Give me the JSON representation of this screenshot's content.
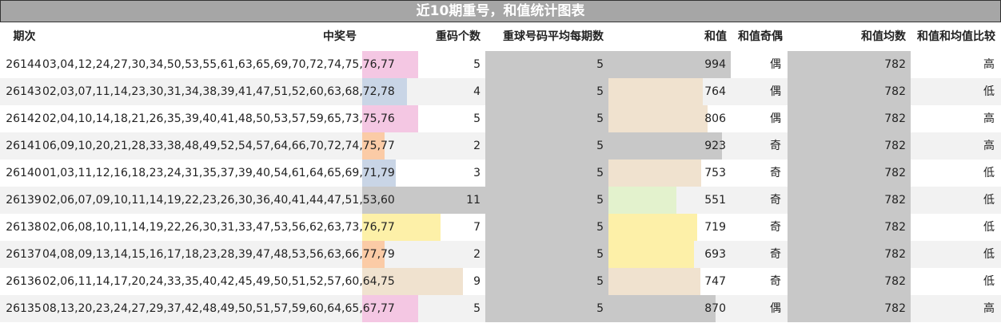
{
  "title": "近10期重号，和值统计图表",
  "headers": {
    "issue": "期次",
    "numbers": "中奖号",
    "repeat_count": "重码个数",
    "avg_repeat": "重球号码平均每期数",
    "sum": "和值",
    "parity": "和值奇偶",
    "sum_avg": "和值均数",
    "compare": "和值和均值比较"
  },
  "colors": {
    "pink": "#f4c7e3",
    "blue": "#c9d5e6",
    "orange": "#fbcba6",
    "gray": "#c8c8c8",
    "yellow": "#fdf0a8",
    "tan": "#f0e2cf",
    "green": "#e3f2cd",
    "stripe": "#f2f2f2"
  },
  "rows": [
    {
      "issue": "26144",
      "numbers": "03,04,12,24,27,30,34,50,53,55,61,63,65,69,70,72,74,75,76,77",
      "repeat": "5",
      "avg": "5",
      "sum": "994",
      "parity": "偶",
      "sum_avg": "782",
      "compare": "高"
    },
    {
      "issue": "26143",
      "numbers": "02,03,07,11,14,23,30,31,34,38,39,41,47,51,52,60,63,68,72,78",
      "repeat": "4",
      "avg": "5",
      "sum": "764",
      "parity": "偶",
      "sum_avg": "782",
      "compare": "低"
    },
    {
      "issue": "26142",
      "numbers": "02,04,10,14,18,21,26,35,39,40,41,48,50,53,57,59,65,73,75,76",
      "repeat": "5",
      "avg": "5",
      "sum": "806",
      "parity": "偶",
      "sum_avg": "782",
      "compare": "高"
    },
    {
      "issue": "26141",
      "numbers": "06,09,10,20,21,28,33,38,48,49,52,54,57,64,66,70,72,74,75,77",
      "repeat": "2",
      "avg": "5",
      "sum": "923",
      "parity": "奇",
      "sum_avg": "782",
      "compare": "高"
    },
    {
      "issue": "26140",
      "numbers": "01,03,11,12,16,18,23,24,31,35,37,39,40,54,61,64,65,69,71,79",
      "repeat": "3",
      "avg": "5",
      "sum": "753",
      "parity": "奇",
      "sum_avg": "782",
      "compare": "低"
    },
    {
      "issue": "26139",
      "numbers": "02,06,07,09,10,11,14,19,22,23,26,30,36,40,41,44,47,51,53,60",
      "repeat": "11",
      "avg": "5",
      "sum": "551",
      "parity": "奇",
      "sum_avg": "782",
      "compare": "低"
    },
    {
      "issue": "26138",
      "numbers": "02,06,08,10,11,14,19,22,26,30,31,33,47,53,56,62,63,73,76,77",
      "repeat": "7",
      "avg": "5",
      "sum": "719",
      "parity": "奇",
      "sum_avg": "782",
      "compare": "低"
    },
    {
      "issue": "26137",
      "numbers": "04,08,09,13,14,15,16,17,18,23,28,39,47,48,53,56,63,66,77,79",
      "repeat": "2",
      "avg": "5",
      "sum": "693",
      "parity": "奇",
      "sum_avg": "782",
      "compare": "低"
    },
    {
      "issue": "26136",
      "numbers": "02,06,11,14,17,20,24,33,35,40,42,45,49,50,51,52,57,60,64,75",
      "repeat": "9",
      "avg": "5",
      "sum": "747",
      "parity": "奇",
      "sum_avg": "782",
      "compare": "低"
    },
    {
      "issue": "26135",
      "numbers": "08,13,20,23,24,27,29,37,42,48,49,50,51,57,59,60,64,65,67,77",
      "repeat": "5",
      "avg": "5",
      "sum": "870",
      "parity": "偶",
      "sum_avg": "782",
      "compare": "高"
    }
  ],
  "chart_data": {
    "type": "table",
    "title": "近10期重号，和值统计图表",
    "columns": [
      "期次",
      "中奖号",
      "重码个数",
      "重球号码平均每期数",
      "和值",
      "和值奇偶",
      "和值均数",
      "和值和均值比较"
    ],
    "repeat_counts": [
      5,
      4,
      5,
      2,
      3,
      11,
      7,
      2,
      9,
      5
    ],
    "repeat_colors": [
      "pink",
      "blue",
      "pink",
      "orange",
      "blue",
      "gray",
      "yellow",
      "orange",
      "tan",
      "pink"
    ],
    "avg_repeat": 5,
    "repeat_max": 11,
    "sums": [
      994,
      764,
      806,
      923,
      753,
      551,
      719,
      693,
      747,
      870
    ],
    "sum_colors": [
      "gray",
      "tan",
      "tan",
      "gray",
      "tan",
      "green",
      "yellow",
      "yellow",
      "tan",
      "gray"
    ],
    "sum_max": 1000,
    "sum_avg": 782
  }
}
